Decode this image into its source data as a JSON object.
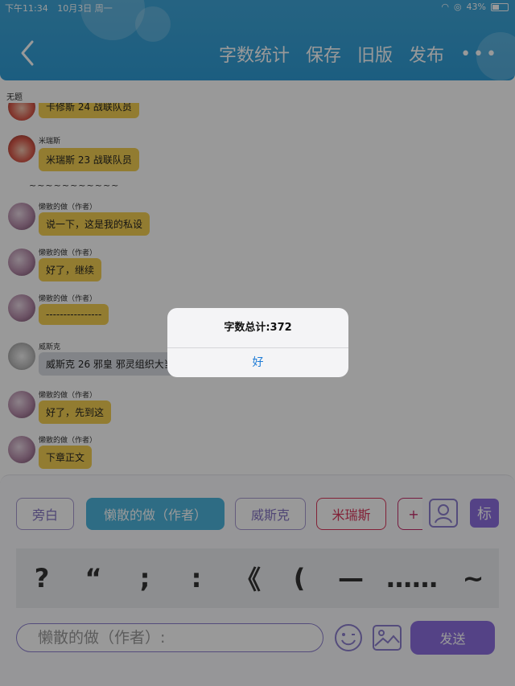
{
  "status": {
    "time": "下午11:34",
    "date": "10月3日 周一",
    "battery": "43%"
  },
  "header": {
    "nav": [
      "字数统计",
      "保存",
      "旧版",
      "发布"
    ],
    "more": "•••"
  },
  "doc_title": "无题",
  "messages": [
    {
      "name": "",
      "text": "卡修斯 24 战联队员",
      "style": "yellow",
      "avatar": "rabbit"
    },
    {
      "name": "米瑞斯",
      "text": "米瑞斯 23 战联队员",
      "style": "yellow",
      "avatar": "rabbit"
    },
    {
      "name": "懒散的做（作者）",
      "text": "说一下，这是我的私设",
      "style": "yellow",
      "avatar": "author"
    },
    {
      "name": "懒散的做（作者）",
      "text": "好了，继续",
      "style": "yellow",
      "avatar": "author"
    },
    {
      "name": "懒散的做（作者）",
      "text": "----------------",
      "style": "yellow",
      "avatar": "author"
    },
    {
      "name": "威斯克",
      "text": "威斯克 26 邪皇 邪灵组织大当",
      "style": "gray",
      "avatar": "gray"
    },
    {
      "name": "懒散的做（作者）",
      "text": "好了，先到这",
      "style": "yellow",
      "avatar": "author"
    },
    {
      "name": "懒散的做（作者）",
      "text": "下章正文",
      "style": "yellow",
      "avatar": "author"
    }
  ],
  "divider": "~~~~~~~~~~~",
  "roles": [
    "旁白",
    "懒散的做（作者）",
    "威斯克",
    "米瑞斯",
    "+"
  ],
  "mark_label": "标",
  "punctuation": [
    "?",
    "“",
    ";",
    ":",
    "《",
    "(",
    "—",
    "……",
    "~"
  ],
  "input": {
    "placeholder": "懒散的做（作者）:"
  },
  "send_label": "发送",
  "alert": {
    "message": "字数总计:372",
    "button": "好"
  },
  "colors": {
    "header": "#2f9cd6",
    "accent": "#8c6fe0",
    "bubble": "#f4cf52",
    "active_role": "#4db5dc"
  }
}
